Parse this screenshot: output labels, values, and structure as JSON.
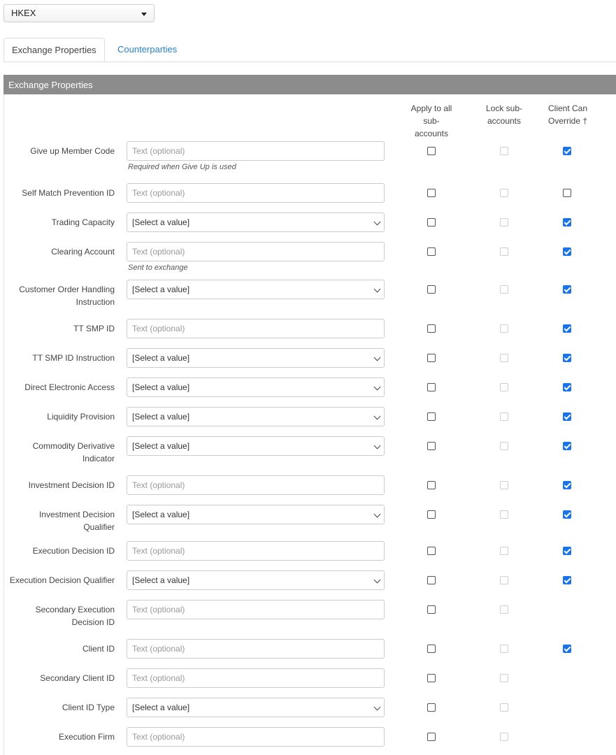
{
  "exchange": {
    "selected": "HKEX"
  },
  "tabs": [
    {
      "label": "Exchange Properties"
    },
    {
      "label": "Counterparties"
    }
  ],
  "panel": {
    "title": "Exchange Properties",
    "columns": {
      "apply_line1": "Apply to all",
      "apply_line2": "sub-accounts",
      "lock_line1": "Lock sub-",
      "lock_line2": "accounts",
      "override_line1": "Client Can",
      "override_line2": "Override †"
    },
    "rows": [
      {
        "label": "Give up Member Code",
        "control": "text",
        "value": "Text (optional)",
        "help": "Required when Give Up is used",
        "apply": false,
        "lock": false,
        "override": true
      },
      {
        "label": "Self Match Prevention ID",
        "control": "text",
        "value": "Text (optional)",
        "apply": false,
        "lock": false,
        "override": false
      },
      {
        "label": "Trading Capacity",
        "control": "select",
        "value": "[Select a value]",
        "apply": false,
        "lock": false,
        "override": true
      },
      {
        "label": "Clearing Account",
        "control": "text",
        "value": "Text (optional)",
        "help": "Sent to exchange",
        "apply": false,
        "lock": false,
        "override": true
      },
      {
        "label_line1": "Customer Order Handling",
        "label_line2": "Instruction",
        "control": "select",
        "value": "[Select a value]",
        "apply": false,
        "lock": false,
        "override": true
      },
      {
        "label": "TT SMP ID",
        "control": "text",
        "value": "Text (optional)",
        "apply": false,
        "lock": false,
        "override": true
      },
      {
        "label": "TT SMP ID Instruction",
        "control": "select",
        "value": "[Select a value]",
        "apply": false,
        "lock": false,
        "override": true
      },
      {
        "label": "Direct Electronic Access",
        "control": "select",
        "value": "[Select a value]",
        "apply": false,
        "lock": false,
        "override": true
      },
      {
        "label": "Liquidity Provision",
        "control": "select",
        "value": "[Select a value]",
        "apply": false,
        "lock": false,
        "override": true
      },
      {
        "label_line1": "Commodity Derivative",
        "label_line2": "Indicator",
        "control": "select",
        "value": "[Select a value]",
        "apply": false,
        "lock": false,
        "override": true
      },
      {
        "label": "Investment Decision ID",
        "control": "text",
        "value": "Text (optional)",
        "apply": false,
        "lock": false,
        "override": true
      },
      {
        "label_line1": "Investment Decision",
        "label_line2": "Qualifier",
        "control": "select",
        "value": "[Select a value]",
        "apply": false,
        "lock": false,
        "override": true
      },
      {
        "label": "Execution Decision ID",
        "control": "text",
        "value": "Text (optional)",
        "apply": false,
        "lock": false,
        "override": true
      },
      {
        "label": "Execution Decision Qualifier",
        "control": "select",
        "value": "[Select a value]",
        "apply": false,
        "lock": false,
        "override": true
      },
      {
        "label_line1": "Secondary Execution",
        "label_line2": "Decision ID",
        "control": "text",
        "value": "Text (optional)",
        "apply": false,
        "lock": false,
        "override": null
      },
      {
        "label": "Client ID",
        "control": "text",
        "value": "Text (optional)",
        "apply": false,
        "lock": false,
        "override": true
      },
      {
        "label": "Secondary Client ID",
        "control": "text",
        "value": "Text (optional)",
        "apply": false,
        "lock": false,
        "override": null
      },
      {
        "label": "Client ID Type",
        "control": "select",
        "value": "[Select a value]",
        "apply": false,
        "lock": false,
        "override": null
      },
      {
        "label": "Execution Firm",
        "control": "text",
        "value": "Text (optional)",
        "apply": false,
        "lock": false,
        "override": null
      }
    ]
  }
}
